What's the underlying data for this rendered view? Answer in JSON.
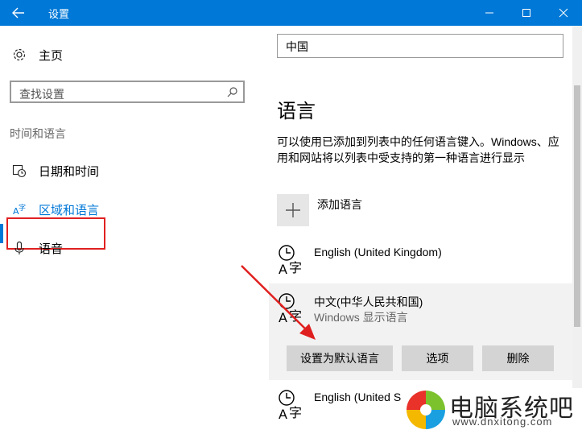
{
  "window": {
    "title": "设置",
    "back_icon": "back-arrow-icon",
    "minimize_icon": "minimize-icon",
    "maximize_icon": "maximize-icon",
    "close_icon": "close-icon"
  },
  "sidebar": {
    "home_label": "主页",
    "search_placeholder": "查找设置",
    "section_title": "时间和语言",
    "items": [
      {
        "label": "日期和时间",
        "icon": "calendar-clock-icon"
      },
      {
        "label": "区域和语言",
        "icon": "language-icon"
      },
      {
        "label": "语音",
        "icon": "microphone-icon"
      }
    ]
  },
  "main": {
    "region_value": "中国",
    "languages_heading": "语言",
    "description": "可以使用已添加到列表中的任何语言键入。Windows、应用和网站将以列表中受支持的第一种语言进行显示",
    "add_language_label": "添加语言",
    "languages": [
      {
        "name": "English (United Kingdom)",
        "sub": ""
      },
      {
        "name": "中文(中华人民共和国)",
        "sub": "Windows 显示语言"
      },
      {
        "name": "English (United S",
        "sub": ""
      }
    ],
    "buttons": {
      "set_default": "设置为默认语言",
      "options": "选项",
      "remove": "删除"
    }
  },
  "watermark": {
    "name": "电脑系统吧",
    "url": "www.dnxitong.com"
  },
  "colors": {
    "accent": "#0078d7",
    "highlight_box": "#e02020",
    "arrow": "#e02020"
  }
}
